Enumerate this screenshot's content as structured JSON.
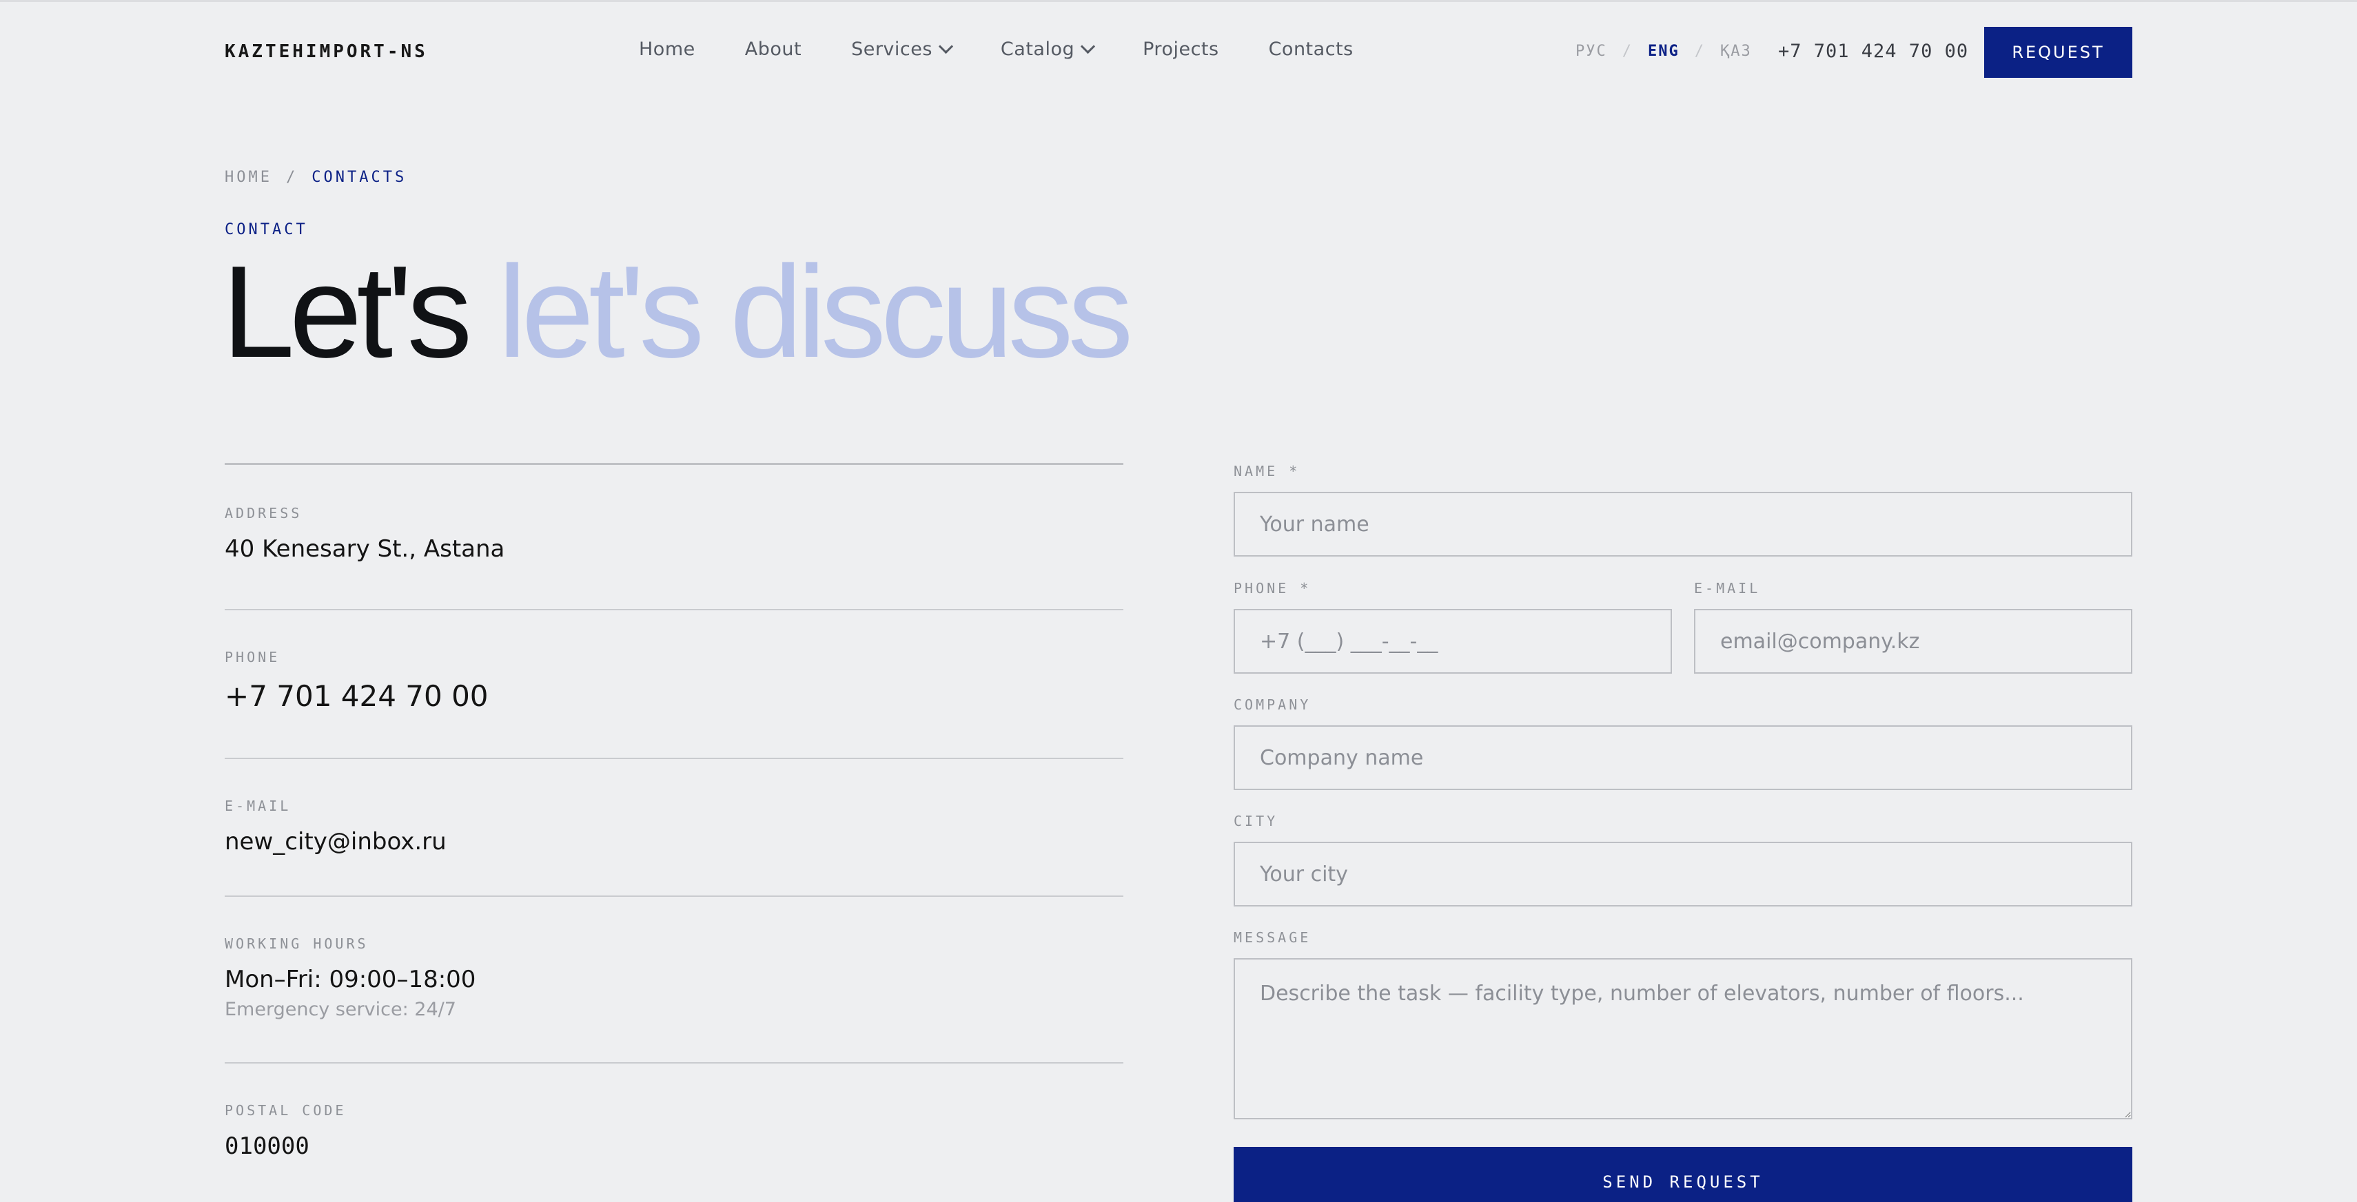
{
  "header": {
    "logo": "KAZTEHIMPORT-NS",
    "nav": [
      {
        "label": "Home",
        "dropdown": false
      },
      {
        "label": "About",
        "dropdown": false
      },
      {
        "label": "Services",
        "dropdown": true
      },
      {
        "label": "Catalog",
        "dropdown": true
      },
      {
        "label": "Projects",
        "dropdown": false
      },
      {
        "label": "Contacts",
        "dropdown": false
      }
    ],
    "languages": [
      {
        "label": "РУС",
        "active": false
      },
      {
        "label": "ENG",
        "active": true
      },
      {
        "label": "ҚАЗ",
        "active": false
      }
    ],
    "phone": "+7 701 424 70 00",
    "request_button": "REQUEST"
  },
  "breadcrumb": {
    "home": "HOME",
    "separator": "/",
    "current": "CONTACTS"
  },
  "page": {
    "eyebrow": "CONTACT",
    "title_dark": "Let's",
    "title_light": "let's discuss"
  },
  "info": {
    "address": {
      "label": "ADDRESS",
      "value": "40 Kenesary St., Astana"
    },
    "phone": {
      "label": "PHONE",
      "value": "+7 701 424 70 00"
    },
    "email": {
      "label": "E-MAIL",
      "value": "new_city@inbox.ru"
    },
    "hours": {
      "label": "WORKING HOURS",
      "value": "Mon–Fri: 09:00–18:00",
      "sub": "Emergency service: 24/7"
    },
    "postal": {
      "label": "POSTAL CODE",
      "value": "010000"
    }
  },
  "form": {
    "name": {
      "label": "NAME *",
      "placeholder": "Your name"
    },
    "phone": {
      "label": "PHONE *",
      "placeholder": "+7 (___) ___-__-__"
    },
    "email": {
      "label": "E-MAIL",
      "placeholder": "email@company.kz"
    },
    "company": {
      "label": "COMPANY",
      "placeholder": "Company name"
    },
    "city": {
      "label": "CITY",
      "placeholder": "Your city"
    },
    "message": {
      "label": "MESSAGE",
      "placeholder": "Describe the task — facility type, number of elevators, number of floors..."
    },
    "submit": "SEND REQUEST"
  },
  "colors": {
    "accent": "#0b2185",
    "title_light": "#b6c2e8",
    "background": "#eeeff1"
  }
}
